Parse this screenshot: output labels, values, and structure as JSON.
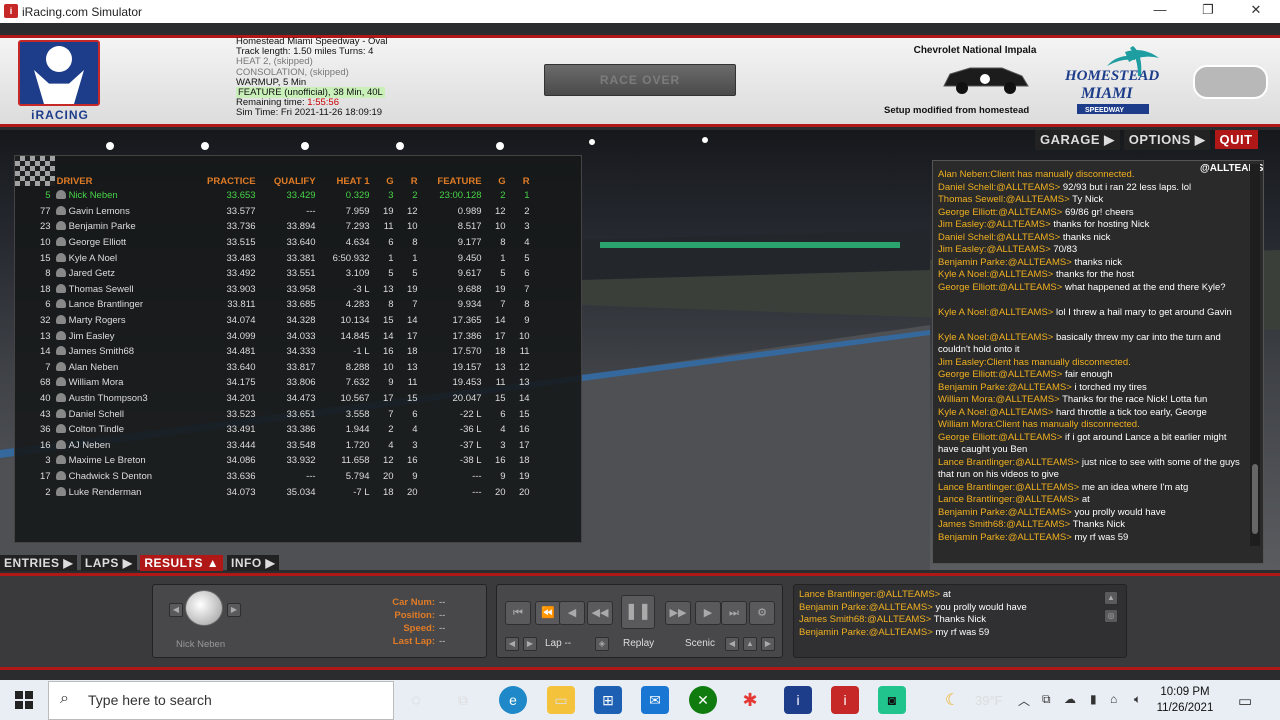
{
  "window": {
    "title": "iRacing.com Simulator",
    "app_icon_name": "iracing-app-icon",
    "minimize": "—",
    "maximize": "❐",
    "close": "✕"
  },
  "logo": {
    "text": "iRACING"
  },
  "track": {
    "name": "Homestead Miami Speedway - Oval",
    "length": "Track length: 1.50 miles Turns: 4",
    "sessions": [
      "HEAT 2, (skipped)",
      "CONSOLATION, (skipped)",
      "WARMUP, 5 Min"
    ],
    "feature": "FEATURE (unofficial), 38 Min, 40L",
    "remaining_label": "Remaining time: ",
    "remaining_value": "1:55:56",
    "simtime": "Sim Time: Fri 2021-11-26 18:09:19"
  },
  "race_over_button": "RACE OVER",
  "car": {
    "name": "Chevrolet National Impala",
    "setup": "Setup modified from homestead"
  },
  "homestead_logo": {
    "line1": "HOMESTEAD",
    "line2": "MIAMI",
    "line3": "SPEEDWAY"
  },
  "top_nav": {
    "garage": "GARAGE ▶",
    "options": "OPTIONS ▶",
    "quit": "QUIT"
  },
  "results": {
    "headers": [
      "DRIVER",
      "PRACTICE",
      "QUALIFY",
      "HEAT 1",
      "G",
      "R",
      "FEATURE",
      "G",
      "R"
    ],
    "rows": [
      {
        "num": "5",
        "driver": "Nick Neben",
        "practice": "33.653",
        "qualify": "33.429",
        "heat1": "0.329",
        "g1": "3",
        "r1": "2",
        "feature": "23:00.128",
        "g2": "2",
        "r2": "1",
        "me": true
      },
      {
        "num": "77",
        "driver": "Gavin Lemons",
        "practice": "33.577",
        "qualify": "---",
        "heat1": "7.959",
        "g1": "19",
        "r1": "12",
        "feature": "0.989",
        "g2": "12",
        "r2": "2"
      },
      {
        "num": "23",
        "driver": "Benjamin Parke",
        "practice": "33.736",
        "qualify": "33.894",
        "heat1": "7.293",
        "g1": "11",
        "r1": "10",
        "feature": "8.517",
        "g2": "10",
        "r2": "3"
      },
      {
        "num": "10",
        "driver": "George Elliott",
        "practice": "33.515",
        "qualify": "33.640",
        "heat1": "4.634",
        "g1": "6",
        "r1": "8",
        "feature": "9.177",
        "g2": "8",
        "r2": "4"
      },
      {
        "num": "15",
        "driver": "Kyle A Noel",
        "practice": "33.483",
        "qualify": "33.381",
        "heat1": "6:50.932",
        "g1": "1",
        "r1": "1",
        "feature": "9.450",
        "g2": "1",
        "r2": "5"
      },
      {
        "num": "8",
        "driver": "Jared Getz",
        "practice": "33.492",
        "qualify": "33.551",
        "heat1": "3.109",
        "g1": "5",
        "r1": "5",
        "feature": "9.617",
        "g2": "5",
        "r2": "6"
      },
      {
        "num": "18",
        "driver": "Thomas Sewell",
        "practice": "33.903",
        "qualify": "33.958",
        "heat1": "-3 L",
        "g1": "13",
        "r1": "19",
        "feature": "9.688",
        "g2": "19",
        "r2": "7"
      },
      {
        "num": "6",
        "driver": "Lance Brantlinger",
        "practice": "33.811",
        "qualify": "33.685",
        "heat1": "4.283",
        "g1": "8",
        "r1": "7",
        "feature": "9.934",
        "g2": "7",
        "r2": "8"
      },
      {
        "num": "32",
        "driver": "Marty Rogers",
        "practice": "34.074",
        "qualify": "34.328",
        "heat1": "10.134",
        "g1": "15",
        "r1": "14",
        "feature": "17.365",
        "g2": "14",
        "r2": "9"
      },
      {
        "num": "13",
        "driver": "Jim Easley",
        "practice": "34.099",
        "qualify": "34.033",
        "heat1": "14.845",
        "g1": "14",
        "r1": "17",
        "feature": "17.386",
        "g2": "17",
        "r2": "10"
      },
      {
        "num": "14",
        "driver": "James Smith68",
        "practice": "34.481",
        "qualify": "34.333",
        "heat1": "-1 L",
        "g1": "16",
        "r1": "18",
        "feature": "17.570",
        "g2": "18",
        "r2": "11"
      },
      {
        "num": "7",
        "driver": "Alan Neben",
        "practice": "33.640",
        "qualify": "33.817",
        "heat1": "8.288",
        "g1": "10",
        "r1": "13",
        "feature": "19.157",
        "g2": "13",
        "r2": "12"
      },
      {
        "num": "68",
        "driver": "William Mora",
        "practice": "34.175",
        "qualify": "33.806",
        "heat1": "7.632",
        "g1": "9",
        "r1": "11",
        "feature": "19.453",
        "g2": "11",
        "r2": "13"
      },
      {
        "num": "40",
        "driver": "Austin Thompson3",
        "practice": "34.201",
        "qualify": "34.473",
        "heat1": "10.567",
        "g1": "17",
        "r1": "15",
        "feature": "20.047",
        "g2": "15",
        "r2": "14"
      },
      {
        "num": "43",
        "driver": "Daniel Schell",
        "practice": "33.523",
        "qualify": "33.651",
        "heat1": "3.558",
        "g1": "7",
        "r1": "6",
        "feature": "-22 L",
        "g2": "6",
        "r2": "15"
      },
      {
        "num": "36",
        "driver": "Colton Tindle",
        "practice": "33.491",
        "qualify": "33.386",
        "heat1": "1.944",
        "g1": "2",
        "r1": "4",
        "feature": "-36 L",
        "g2": "4",
        "r2": "16"
      },
      {
        "num": "16",
        "driver": "AJ Neben",
        "practice": "33.444",
        "qualify": "33.548",
        "heat1": "1.720",
        "g1": "4",
        "r1": "3",
        "feature": "-37 L",
        "g2": "3",
        "r2": "17"
      },
      {
        "num": "3",
        "driver": "Maxime Le Breton",
        "practice": "34.086",
        "qualify": "33.932",
        "heat1": "11.658",
        "g1": "12",
        "r1": "16",
        "feature": "-38 L",
        "g2": "16",
        "r2": "18"
      },
      {
        "num": "17",
        "driver": "Chadwick S Denton",
        "practice": "33.636",
        "qualify": "---",
        "heat1": "5.794",
        "g1": "20",
        "r1": "9",
        "feature": "---",
        "g2": "9",
        "r2": "19"
      },
      {
        "num": "2",
        "driver": "Luke Renderman",
        "practice": "34.073",
        "qualify": "35.034",
        "heat1": "-7 L",
        "g1": "18",
        "r1": "20",
        "feature": "---",
        "g2": "20",
        "r2": "20"
      }
    ]
  },
  "chat": {
    "tag": "@ALLTEAMS",
    "lines": [
      {
        "name": "Alan Neben:",
        "text": "Client has manually disconnected.",
        "sys": true
      },
      {
        "name": "Daniel Schell:@ALLTEAMS>",
        "text": " 92/93 but i ran 22 less laps. lol"
      },
      {
        "name": "Thomas Sewell:@ALLTEAMS>",
        "text": " Ty Nick"
      },
      {
        "name": "George Elliott:@ALLTEAMS>",
        "text": " 69/86 gr! cheers"
      },
      {
        "name": "Jim Easley:@ALLTEAMS>",
        "text": " thanks for hosting Nick"
      },
      {
        "name": "Daniel Schell:@ALLTEAMS>",
        "text": " thanks nick"
      },
      {
        "name": "Jim Easley:@ALLTEAMS>",
        "text": " 70/83"
      },
      {
        "name": "Benjamin Parke:@ALLTEAMS>",
        "text": " thanks nick"
      },
      {
        "name": "Kyle A Noel:@ALLTEAMS>",
        "text": " thanks for the host"
      },
      {
        "name": "George Elliott:@ALLTEAMS>",
        "text": " what happened at the end there Kyle?",
        "wrap": true
      },
      {
        "name": "Kyle A Noel:@ALLTEAMS>",
        "text": " lol I threw a hail mary to get around Gavin",
        "wrap": true
      },
      {
        "name": "Kyle A Noel:@ALLTEAMS>",
        "text": " basically threw my car into the turn and couldn't hold onto it",
        "wrap": true
      },
      {
        "name": "Jim Easley:",
        "text": "Client has manually disconnected.",
        "sys": true
      },
      {
        "name": "George Elliott:@ALLTEAMS>",
        "text": " fair enough"
      },
      {
        "name": "Benjamin Parke:@ALLTEAMS>",
        "text": " i torched my tires"
      },
      {
        "name": "William Mora:@ALLTEAMS>",
        "text": " Thanks for the race Nick! Lotta fun"
      },
      {
        "name": "Kyle A Noel:@ALLTEAMS>",
        "text": " hard throttle a tick too early, George"
      },
      {
        "name": "William Mora:",
        "text": "Client has manually disconnected.",
        "sys": true
      },
      {
        "name": "George Elliott:@ALLTEAMS>",
        "text": " if i got around Lance a bit earlier might have caught you Ben",
        "wrap": true
      },
      {
        "name": "Lance Brantlinger:@ALLTEAMS>",
        "text": " just nice to see with some of the guys that run on his videos to give",
        "wrap": true
      },
      {
        "name": "Lance Brantlinger:@ALLTEAMS>",
        "text": " me an idea where I'm atg"
      },
      {
        "name": "Lance Brantlinger:@ALLTEAMS>",
        "text": " at"
      },
      {
        "name": "Benjamin Parke:@ALLTEAMS>",
        "text": " you prolly would have"
      },
      {
        "name": "James Smith68:@ALLTEAMS>",
        "text": " Thanks Nick"
      },
      {
        "name": "Benjamin Parke:@ALLTEAMS>",
        "text": " my rf was 59"
      }
    ]
  },
  "bottom_tabs": {
    "entries": "ENTRIES ▶",
    "laps": "LAPS ▶",
    "results": "RESULTS ▲",
    "info": "INFO ▶"
  },
  "car_panel": {
    "name": "Nick Neben",
    "labels": [
      "Car Num:",
      "Position:",
      "Speed:",
      "Last Lap:"
    ],
    "values": [
      "--",
      "--",
      "--",
      "--"
    ]
  },
  "replay": {
    "lap": "Lap --",
    "replay": "Replay",
    "scenic": "Scenic"
  },
  "mini_chat": [
    {
      "name": "Lance Brantlinger:@ALLTEAMS>",
      "text": " at"
    },
    {
      "name": "Benjamin Parke:@ALLTEAMS>",
      "text": " you prolly would have"
    },
    {
      "name": "James Smith68:@ALLTEAMS>",
      "text": " Thanks Nick"
    },
    {
      "name": "Benjamin Parke:@ALLTEAMS>",
      "text": " my rf was 59"
    }
  ],
  "taskbar": {
    "search_placeholder": "Type here to search",
    "weather": "39°F",
    "time": "10:09 PM",
    "date": "11/26/2021"
  }
}
